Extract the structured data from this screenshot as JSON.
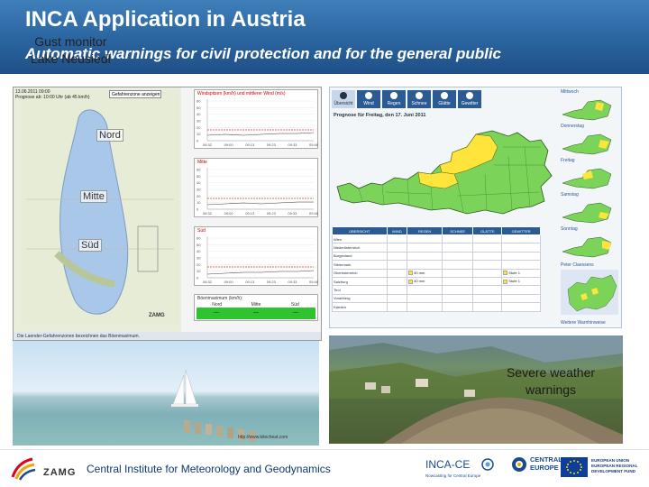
{
  "slide": {
    "title": "INCA Application in Austria",
    "subtitle": "Automatic warnings for civil protection and for the general public"
  },
  "gust_monitor": {
    "header_lines": [
      "13.06.2011 09:00",
      "Prognose ab: 10:00 Uhr (ab 45 km/h)"
    ],
    "legend_button": "Gefahrenzone anzeigen",
    "regions": [
      "Nord",
      "Mitte",
      "Süd"
    ],
    "chart_titles": [
      "Windspitzen (km/h) und mittlerer Wind (m/s)",
      "Mitte",
      "Süd"
    ],
    "chart_y_ticks": [
      "60",
      "50",
      "40",
      "30",
      "20",
      "10",
      "0"
    ],
    "chart_x_ticks": [
      "08:32",
      "09:00",
      "09:13",
      "09:23",
      "09:33",
      "09:48"
    ],
    "table_header": "Böenmaximum (km/h):",
    "table_columns": [
      "Nord",
      "Mitte",
      "Süd"
    ],
    "table_values": [
      "---",
      "---",
      "---"
    ],
    "zamg_mark": "ZAMG",
    "map_footer": "Die Laender-Gefahrenzonen bezeichnen das Böenmaximum."
  },
  "warning_portal": {
    "tabs": [
      {
        "label": "Übersicht",
        "icon": "overview-icon",
        "active": true
      },
      {
        "label": "Wind",
        "icon": "wind-icon",
        "active": false
      },
      {
        "label": "Regen",
        "icon": "rain-icon",
        "active": false
      },
      {
        "label": "Schnee",
        "icon": "snow-icon",
        "active": false
      },
      {
        "label": "Glätte",
        "icon": "ice-icon",
        "active": false
      },
      {
        "label": "Gewitter",
        "icon": "thunderstorm-icon",
        "active": false
      }
    ],
    "forecast_title": "Prognose für Freitag, den 17. Juni 2011",
    "table_headers": [
      "ÜBERSICHT",
      "WIND",
      "REGEN",
      "SCHNEE",
      "GLÄTTE",
      "GEWITTER"
    ],
    "table_rows": [
      {
        "state": "Wien",
        "regen": "",
        "gewitter": ""
      },
      {
        "state": "Niederösterreich",
        "regen": "",
        "gewitter": ""
      },
      {
        "state": "Burgenland",
        "regen": "",
        "gewitter": ""
      },
      {
        "state": "Steiermark",
        "regen": "",
        "gewitter": ""
      },
      {
        "state": "Oberösterreich",
        "regen": "40 mm",
        "gewitter": "Stufe 1"
      },
      {
        "state": "Salzburg",
        "regen": "40 mm",
        "gewitter": "Stufe 1"
      },
      {
        "state": "Tirol",
        "regen": "",
        "gewitter": ""
      },
      {
        "state": "Vorarlberg",
        "regen": "",
        "gewitter": ""
      },
      {
        "state": "Kärnten",
        "regen": "",
        "gewitter": ""
      }
    ],
    "day_labels": [
      "Mittwoch",
      "Donnerstag",
      "Freitag",
      "Samstag",
      "Sonntag"
    ],
    "europe_label": "Peter Claessens",
    "more_link": "Weitere Warnhinweise",
    "colors": {
      "nav": "#2c5b93",
      "ok": "#7cd35a",
      "warning": "#ffe53b"
    }
  },
  "photos": {
    "gust_caption": [
      "Gust monitor",
      "Lake Neusiedl"
    ],
    "lake_url": "http://www.kitecheat.com",
    "severe_caption": [
      "Severe weather",
      "warnings"
    ]
  },
  "footer": {
    "zamg": "ZAMG",
    "institute": "Central Institute for Meteorology and Geodynamics",
    "inca_ce": "INCA-CE",
    "inca_ce_sub": "Nowcasting for Central Europe",
    "central_europe": [
      "CENTRAL",
      "EUROPE"
    ],
    "eu_text": [
      "EUROPEAN UNION",
      "EUROPEAN REGIONAL",
      "DEVELOPMENT FUND"
    ]
  }
}
